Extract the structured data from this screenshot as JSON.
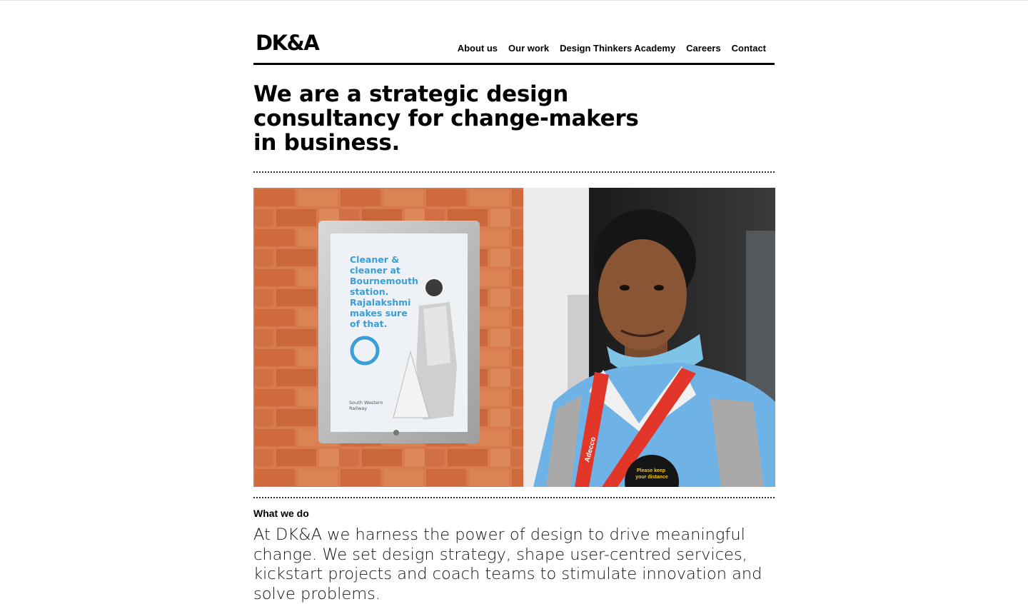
{
  "header": {
    "logo": "DK&A",
    "nav": [
      {
        "label": "About us"
      },
      {
        "label": "Our work"
      },
      {
        "label": "Design Thinkers Academy"
      },
      {
        "label": "Careers"
      },
      {
        "label": "Contact"
      }
    ]
  },
  "hero": {
    "title": "We are a strategic design consultancy for change-makers in business."
  },
  "photo": {
    "poster": {
      "lines": [
        "Cleaner &",
        "cleaner at",
        "Bournemouth",
        "station.",
        "Rajalakshmi",
        "makes sure",
        "of that."
      ],
      "footer_line1": "South Western",
      "footer_line2": "Railway"
    },
    "lanyard_text": "Adecco",
    "badge_line1": "Please keep",
    "badge_line2": "your distance"
  },
  "what_we_do": {
    "label": "What we do",
    "text": "At DK&A we harness the power of design to drive meaningful change. We set design strategy, shape user-centred services, kickstart projects and coach teams to stimulate innovation and solve problems."
  },
  "colors": {
    "text": "#000000",
    "background": "#ffffff",
    "poster_blue": "#3a9fd8",
    "vest_blue": "#6fb3e6",
    "lanyard_red": "#e2362a"
  }
}
